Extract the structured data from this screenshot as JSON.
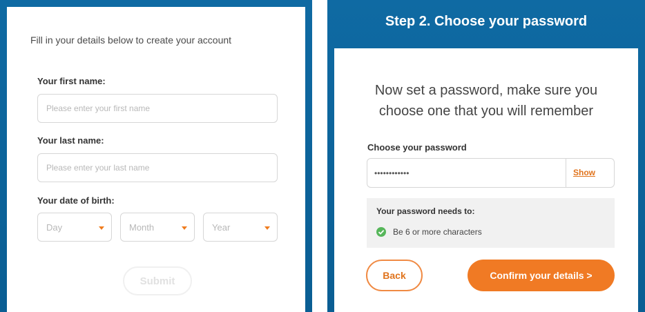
{
  "left_form": {
    "intro": "Fill in your details below to create your account",
    "first_name_label": "Your first name:",
    "first_name_placeholder": "Please enter your first name",
    "last_name_label": "Your last name:",
    "last_name_placeholder": "Please enter your last name",
    "dob_label": "Your date of birth:",
    "dob_day": "Day",
    "dob_month": "Month",
    "dob_year": "Year",
    "submit": "Submit"
  },
  "right_form": {
    "step_title": "Step 2. Choose your password",
    "heading": "Now set a password, make sure you choose one that you will remember",
    "password_label": "Choose your password",
    "password_value": "••••••••••••",
    "show": "Show",
    "requirements_title": "Your password needs to:",
    "requirement": "Be 6 or more characters",
    "back": "Back",
    "confirm": "Confirm your details >"
  },
  "colors": {
    "frame_blue": "#0f6aa3",
    "accent_orange": "#f07a24",
    "success_green": "#56b65a"
  },
  "icons": {
    "caret": "caret-down-icon",
    "check": "check-circle-icon"
  }
}
